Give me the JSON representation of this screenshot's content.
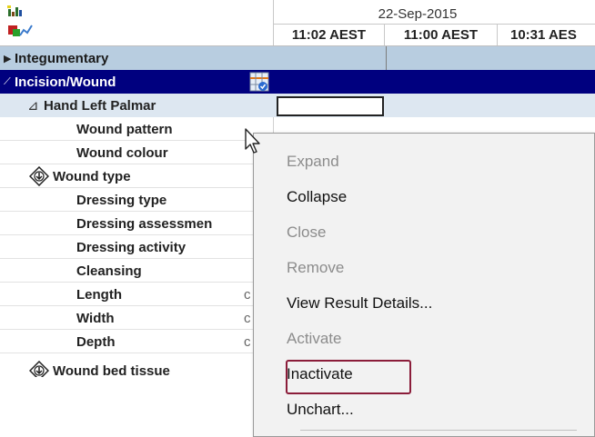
{
  "header": {
    "date": "22-Sep-2015",
    "times": [
      "11:02 AEST",
      "11:00 AEST",
      "10:31 AES"
    ]
  },
  "rows": [
    {
      "label": "Integumentary",
      "marker": "▶"
    },
    {
      "label": "Incision/Wound",
      "marker": "⟋"
    },
    {
      "label": "Hand Left Palmar",
      "marker": "⊿"
    },
    {
      "label": "Wound pattern"
    },
    {
      "label": "Wound colour"
    },
    {
      "label": "Wound type"
    },
    {
      "label": "Dressing type"
    },
    {
      "label": "Dressing assessmen"
    },
    {
      "label": "Dressing activity"
    },
    {
      "label": "Cleansing"
    },
    {
      "label": "Length",
      "unit": "c"
    },
    {
      "label": "Width",
      "unit": "c"
    },
    {
      "label": "Depth",
      "unit": "c"
    },
    {
      "label": "Wound bed tissue"
    }
  ],
  "menu": {
    "items": [
      {
        "label": "Expand",
        "enabled": false
      },
      {
        "label": "Collapse",
        "enabled": true
      },
      {
        "label": "Close",
        "enabled": false
      },
      {
        "label": "Remove",
        "enabled": false
      },
      {
        "label": "View Result Details...",
        "enabled": true
      },
      {
        "label": "Activate",
        "enabled": false
      },
      {
        "label": "Inactivate",
        "enabled": true
      },
      {
        "label": "Unchart...",
        "enabled": true
      }
    ]
  },
  "colors": {
    "section_bg": "#b8cde0",
    "selected_bg": "#00007f",
    "subsection_bg": "#b8cde0",
    "highlight_border": "#8b1d3a"
  },
  "icons": [
    "flowsheet-chart-icon",
    "collapse-arrow-icon",
    "expand-triangle-icon",
    "task-grid-icon",
    "mouse-pointer-icon",
    "diamond-arrow-icon"
  ]
}
